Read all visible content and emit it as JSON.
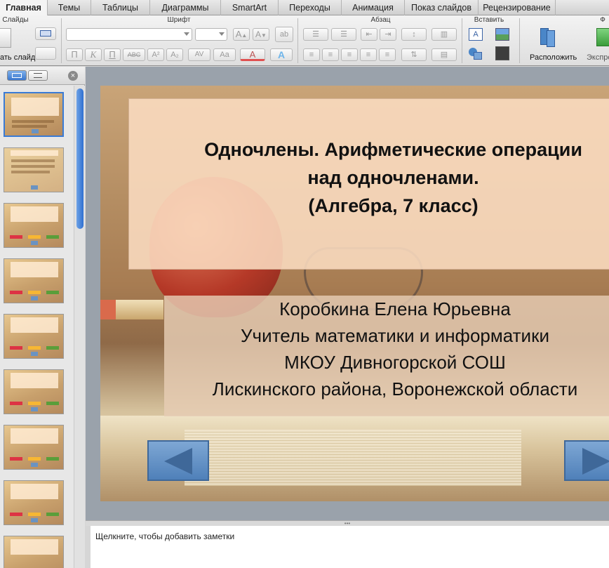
{
  "ribbon_tabs": [
    "Главная",
    "Темы",
    "Таблицы",
    "Диаграммы",
    "SmartArt",
    "Переходы",
    "Анимация",
    "Показ слайдов",
    "Рецензирование"
  ],
  "groups": {
    "slides": "Слайды",
    "font": "Шрифт",
    "paragraph": "Абзац",
    "insert": "Вставить",
    "format": "Ф"
  },
  "buttons": {
    "new_slide": "ать слайд",
    "arrange": "Расположить",
    "express": "Экспрес"
  },
  "font_buttons": [
    "П",
    "К",
    "П",
    "ABC",
    "A²",
    "A₂",
    "AV",
    "Aa",
    "A",
    "A"
  ],
  "slide": {
    "title_lines": [
      "Одночлены. Арифметические операции",
      "над одночленами.",
      "(Алгебра, 7 класс)"
    ],
    "author_lines": [
      "Коробкина Елена Юрьевна",
      "Учитель математики и информатики",
      "МКОУ Дивногорской СОШ",
      "Лискинского района, Воронежской области"
    ]
  },
  "notes_placeholder": "Щелкните, чтобы добавить заметки",
  "colors": {
    "accent": "#3a7bd5",
    "title_box": "#fbdcc0",
    "nav_button": "#5f8fc7"
  },
  "icons": [
    "close-icon",
    "slide-view-icon",
    "outline-view-icon",
    "prev-arrow-icon",
    "next-arrow-icon"
  ]
}
